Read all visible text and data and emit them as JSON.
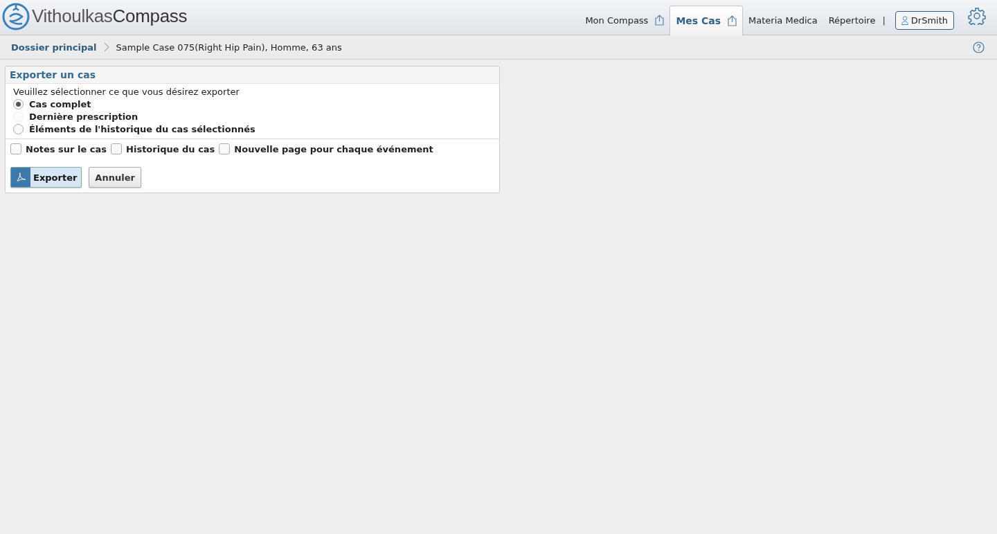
{
  "header": {
    "logo": "Vithoulkas**Compass**",
    "nav": [
      {
        "label": "Mon Compass",
        "selected": false,
        "share": true
      },
      {
        "label": "Mes Cas",
        "selected": true,
        "share": true
      },
      {
        "label": "Materia Medica",
        "selected": false,
        "share": false
      },
      {
        "label": "Répertoire",
        "selected": false,
        "share": false
      }
    ],
    "separator": "|",
    "user": "DrSmith"
  },
  "breadcrumb": {
    "root": "Dossier principal",
    "current": "Sample Case 075(Right Hip Pain), Homme, 63 ans"
  },
  "panel": {
    "title": "Exporter un cas",
    "prompt": "Veuillez sélectionner ce que vous désirez exporter",
    "options": [
      {
        "label": "Cas complet",
        "selected": true,
        "disabled": false
      },
      {
        "label": "Dernière prescription",
        "selected": false,
        "disabled": true
      },
      {
        "label": "Éléments de l'historique du cas sélectionnés",
        "selected": false,
        "disabled": false
      }
    ],
    "checkboxes": [
      {
        "label": "Notes sur le cas",
        "checked": false
      },
      {
        "label": "Historique du cas",
        "checked": false
      },
      {
        "label": "Nouvelle page pour chaque événement",
        "checked": false
      }
    ],
    "buttons": [
      {
        "label": "Exporter",
        "kind": "primary"
      },
      {
        "label": "Annuler",
        "kind": "secondary"
      }
    ]
  }
}
